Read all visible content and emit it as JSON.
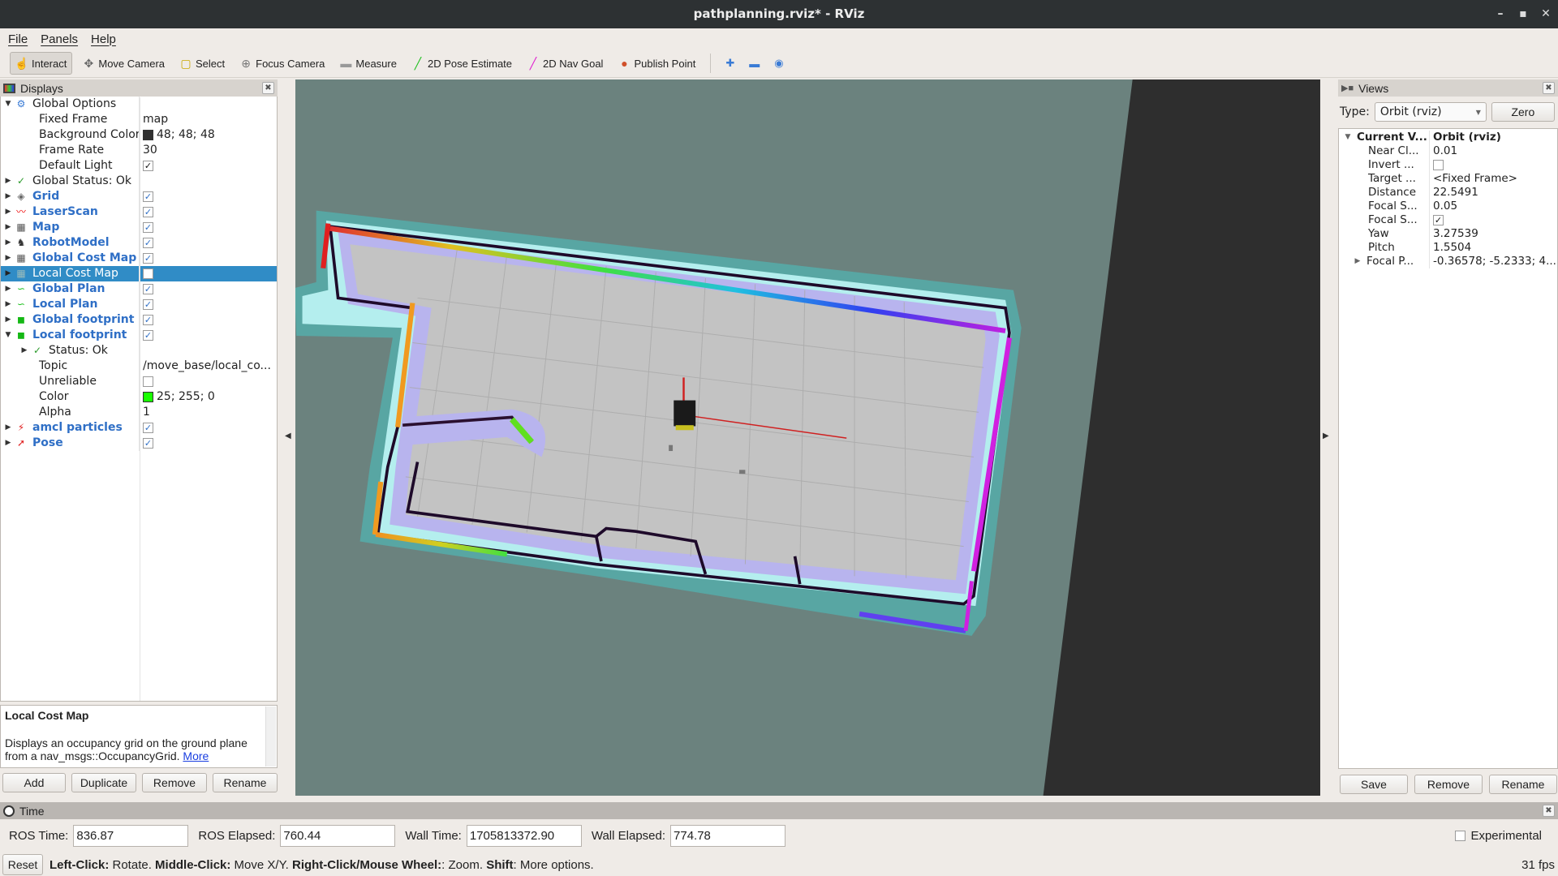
{
  "window": {
    "title": "pathplanning.rviz* - RViz",
    "minimize": "–",
    "maximize": "▪",
    "close": "✕"
  },
  "menu": [
    "File",
    "Panels",
    "Help"
  ],
  "toolbar": [
    {
      "label": "Interact",
      "icon": "hand-icon",
      "glyph": "☝",
      "color": "#333",
      "active": true
    },
    {
      "label": "Move Camera",
      "icon": "move-camera-icon",
      "glyph": "✥",
      "color": "#666"
    },
    {
      "label": "Select",
      "icon": "select-icon",
      "glyph": "▢",
      "color": "#c8a800"
    },
    {
      "label": "Focus Camera",
      "icon": "focus-camera-icon",
      "glyph": "⊕",
      "color": "#777"
    },
    {
      "label": "Measure",
      "icon": "ruler-icon",
      "glyph": "▬",
      "color": "#999"
    },
    {
      "label": "2D Pose Estimate",
      "icon": "pose-estimate-arrow-icon",
      "glyph": "╱",
      "color": "#22c022"
    },
    {
      "label": "2D Nav Goal",
      "icon": "nav-goal-arrow-icon",
      "glyph": "╱",
      "color": "#e020d0"
    },
    {
      "label": "Publish Point",
      "icon": "map-pin-icon",
      "glyph": "●",
      "color": "#d0502a"
    }
  ],
  "toolbar_extra": [
    {
      "icon": "plus-icon",
      "glyph": "✚"
    },
    {
      "icon": "minus-icon",
      "glyph": "▬"
    },
    {
      "icon": "camera-eye-icon",
      "glyph": "◉"
    }
  ],
  "displays": {
    "title": "Displays",
    "rows": [
      {
        "level": 0,
        "exp": "down",
        "icon": "gear-icon",
        "glyph": "⚙",
        "gc": "#3a7bd5",
        "label": "Global Options",
        "kind": "group"
      },
      {
        "level": 1,
        "label": "Fixed Frame",
        "value": "map"
      },
      {
        "level": 1,
        "label": "Background Color",
        "value": "48; 48; 48",
        "swatch": "#303030"
      },
      {
        "level": 1,
        "label": "Frame Rate",
        "value": "30"
      },
      {
        "level": 1,
        "label": "Default Light",
        "check": true
      },
      {
        "level": 0,
        "exp": "right",
        "icon": "checkmark-icon",
        "glyph": "✓",
        "gc": "#2a9a2a",
        "label": "Global Status: Ok",
        "kind": "group"
      },
      {
        "level": 0,
        "exp": "right",
        "icon": "grid-icon",
        "glyph": "◈",
        "gc": "#666",
        "label": "Grid",
        "kind": "display",
        "check": true
      },
      {
        "level": 0,
        "exp": "right",
        "icon": "laser-scan-icon",
        "glyph": "〰",
        "gc": "#e00",
        "label": "LaserScan",
        "kind": "display",
        "check": true
      },
      {
        "level": 0,
        "exp": "right",
        "icon": "map-icon",
        "glyph": "▦",
        "gc": "#555",
        "label": "Map",
        "kind": "display",
        "check": true
      },
      {
        "level": 0,
        "exp": "right",
        "icon": "robot-model-icon",
        "glyph": "♞",
        "gc": "#333",
        "label": "RobotModel",
        "kind": "display",
        "check": true
      },
      {
        "level": 0,
        "exp": "right",
        "icon": "map-icon",
        "glyph": "▦",
        "gc": "#555",
        "label": "Global Cost Map",
        "kind": "display",
        "check": true
      },
      {
        "level": 0,
        "exp": "right",
        "icon": "map-icon",
        "glyph": "▦",
        "gc": "#9bb",
        "label": "Local Cost Map",
        "kind": "display",
        "check": false,
        "selected": true
      },
      {
        "level": 0,
        "exp": "right",
        "icon": "path-icon",
        "glyph": "∽",
        "gc": "#1cc01c",
        "label": "Global Plan",
        "kind": "display",
        "check": true
      },
      {
        "level": 0,
        "exp": "right",
        "icon": "path-icon",
        "glyph": "∽",
        "gc": "#1cc01c",
        "label": "Local Plan",
        "kind": "display",
        "check": true
      },
      {
        "level": 0,
        "exp": "right",
        "icon": "footprint-icon",
        "glyph": "◼",
        "gc": "#14b814",
        "label": "Global footprint",
        "kind": "display",
        "check": true
      },
      {
        "level": 0,
        "exp": "down",
        "icon": "footprint-icon",
        "glyph": "◼",
        "gc": "#14b814",
        "label": "Local footprint",
        "kind": "display",
        "check": true
      },
      {
        "level": 1,
        "exp": "right",
        "icon": "checkmark-icon",
        "glyph": "✓",
        "gc": "#2a9a2a",
        "label": "Status: Ok",
        "kind": "group"
      },
      {
        "level": 1,
        "label": "Topic",
        "value": "/move_base/local_co..."
      },
      {
        "level": 1,
        "label": "Unreliable",
        "check": false,
        "plain": true
      },
      {
        "level": 1,
        "label": "Color",
        "value": "25; 255; 0",
        "swatch": "#19ff00"
      },
      {
        "level": 1,
        "label": "Alpha",
        "value": "1"
      },
      {
        "level": 0,
        "exp": "right",
        "icon": "particles-icon",
        "glyph": "⚡",
        "gc": "#e02020",
        "label": "amcl particles",
        "kind": "display",
        "check": true
      },
      {
        "level": 0,
        "exp": "right",
        "icon": "pose-arrow-icon",
        "glyph": "➚",
        "gc": "#e02020",
        "label": "Pose",
        "kind": "display",
        "check": true
      }
    ],
    "description_title": "Local Cost Map",
    "description": "Displays an occupancy grid on the ground plane from a nav_msgs::OccupancyGrid.",
    "description_link": "More",
    "buttons": [
      "Add",
      "Duplicate",
      "Remove",
      "Rename"
    ]
  },
  "views": {
    "title": "Views",
    "type_label": "Type:",
    "type_value": "Orbit (rviz)",
    "zero": "Zero",
    "rows": [
      {
        "exp": "down",
        "label": "Current V...",
        "value": "Orbit (rviz)",
        "bold": true
      },
      {
        "label": "Near Cl...",
        "value": "0.01"
      },
      {
        "label": "Invert ...",
        "check": false
      },
      {
        "label": "Target ...",
        "value": "<Fixed Frame>"
      },
      {
        "label": "Distance",
        "value": "22.5491"
      },
      {
        "label": "Focal S...",
        "value": "0.05"
      },
      {
        "label": "Focal S...",
        "check": true
      },
      {
        "label": "Yaw",
        "value": "3.27539"
      },
      {
        "label": "Pitch",
        "value": "1.5504"
      },
      {
        "exp": "right",
        "label": "Focal P...",
        "value": "-0.36578; -5.2333; 4...."
      }
    ],
    "buttons": [
      "Save",
      "Remove",
      "Rename"
    ]
  },
  "time": {
    "title": "Time",
    "fields": [
      {
        "label": "ROS Time:",
        "value": "836.87"
      },
      {
        "label": "ROS Elapsed:",
        "value": "760.44"
      },
      {
        "label": "Wall Time:",
        "value": "1705813372.90"
      },
      {
        "label": "Wall Elapsed:",
        "value": "774.78"
      }
    ],
    "experimental": "Experimental"
  },
  "status": {
    "reset": "Reset",
    "hints": [
      {
        "key": "Left-Click:",
        "text": " Rotate. "
      },
      {
        "key": "Middle-Click:",
        "text": " Move X/Y. "
      },
      {
        "key": "Right-Click/Mouse Wheel:",
        "text": ": Zoom. "
      },
      {
        "key": "Shift",
        "text": ": More options."
      }
    ],
    "fps": "31 fps"
  },
  "colors": {
    "viewport_bg": "#6b827e",
    "selection": "#308cc6",
    "display_label": "#2f6fc6"
  }
}
